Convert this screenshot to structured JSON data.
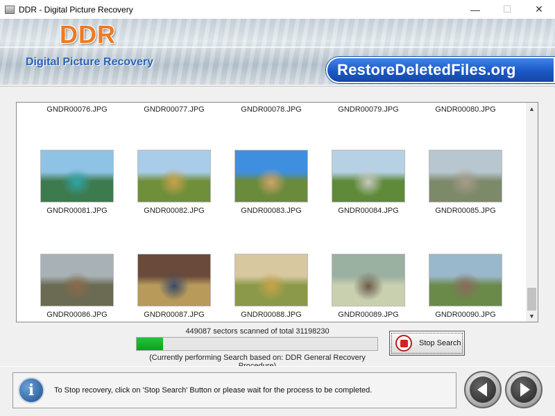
{
  "window": {
    "title": "DDR - Digital Picture Recovery",
    "controls": {
      "minimize": "—",
      "maximize": "☐",
      "close": "✕"
    }
  },
  "banner": {
    "logo": "DDR",
    "subtitle": "Digital Picture Recovery",
    "site": "RestoreDeletedFiles.org"
  },
  "gallery": {
    "rows": [
      [
        {
          "name": "GNDR00076.JPG"
        },
        {
          "name": "GNDR00077.JPG"
        },
        {
          "name": "GNDR00078.JPG"
        },
        {
          "name": "GNDR00079.JPG"
        },
        {
          "name": "GNDR00080.JPG"
        }
      ],
      [
        {
          "name": "GNDR00081.JPG",
          "colors": [
            "#8fc3e6",
            "#3d7a4e",
            "#2fa5a8"
          ]
        },
        {
          "name": "GNDR00082.JPG",
          "colors": [
            "#a9cde8",
            "#6f8f3a",
            "#c9a24a"
          ]
        },
        {
          "name": "GNDR00083.JPG",
          "colors": [
            "#3f8fe0",
            "#6a8a3c",
            "#d1a36a"
          ]
        },
        {
          "name": "GNDR00084.JPG",
          "colors": [
            "#b7d1e4",
            "#5e8a3a",
            "#c8c8c0"
          ]
        },
        {
          "name": "GNDR00085.JPG",
          "colors": [
            "#b8c6cf",
            "#7d8a6a",
            "#a89c8a"
          ]
        }
      ],
      [
        {
          "name": "GNDR00086.JPG",
          "colors": [
            "#a8b2b6",
            "#6b6a52",
            "#8a6a4a"
          ]
        },
        {
          "name": "GNDR00087.JPG",
          "colors": [
            "#6a4a3a",
            "#b89a5a",
            "#3a4a6a"
          ]
        },
        {
          "name": "GNDR00088.JPG",
          "colors": [
            "#d8c8a0",
            "#8a9a4a",
            "#c9a24a"
          ]
        },
        {
          "name": "GNDR00089.JPG",
          "colors": [
            "#9ab0a0",
            "#c8d0b0",
            "#6a5a4a"
          ]
        },
        {
          "name": "GNDR00090.JPG",
          "colors": [
            "#9ab8cc",
            "#6a8a4a",
            "#8a6a5a"
          ]
        }
      ]
    ]
  },
  "progress": {
    "sectors_text": "449087 sectors scanned of total 31198230",
    "fraction": 0.11,
    "procedure_text": "(Currently performing Search based on:  DDR General Recovery Procedure)"
  },
  "stop_button": {
    "label": "Stop Search"
  },
  "footer": {
    "info_glyph": "i",
    "status": "To Stop recovery, click on 'Stop Search' Button or please wait for the process to be completed."
  },
  "colors": {
    "progress": "#08a418",
    "banner_text": "#2a62b8",
    "logo": "#f07a22",
    "badge": "#1c58c4"
  }
}
